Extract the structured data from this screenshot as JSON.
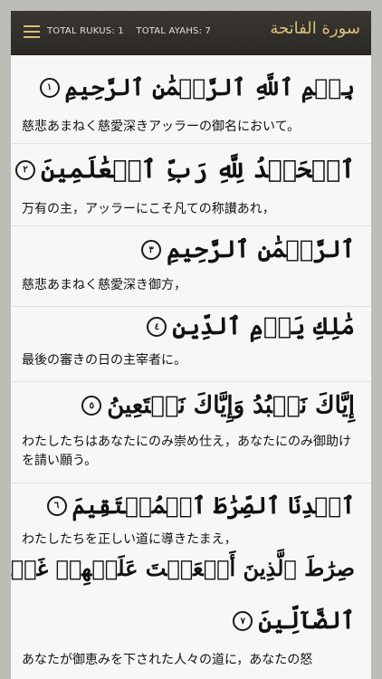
{
  "header": {
    "menu_icon": "hamburger-menu-icon",
    "total_rukus_label": "TOTAL RUKUS: 1",
    "total_ayahs_label": "TOTAL AYAHS: 7",
    "surah_title": "سورة الفاتحة"
  },
  "ayahs": [
    {
      "number": "١",
      "arabic": "بِسۡمِ ٱللَّهِ ٱلرَّحۡمَٰنِ ٱلرَّحِيمِ",
      "translation": "慈悲あまねく慈愛深きアッラーの御名において。"
    },
    {
      "number": "٢",
      "arabic": "ٱلۡحَمۡدُ لِلَّهِ رَبِّ ٱلۡعَٰلَمِينَ",
      "translation": "万有の主，アッラーにこそ凡ての称讃あれ，"
    },
    {
      "number": "٣",
      "arabic": "ٱلرَّحۡمَٰنِ ٱلرَّحِيمِ",
      "translation": "慈悲あまねく慈愛深き御方，"
    },
    {
      "number": "٤",
      "arabic": "مَٰلِكِ يَوۡمِ ٱلدِّينِ",
      "translation": "最後の審きの日の主宰者に。"
    },
    {
      "number": "٥",
      "arabic": "إِيَّاكَ نَعۡبُدُ وَإِيَّاكَ نَسۡتَعِينُ",
      "translation": "わたしたちはあなたにのみ崇め仕え，あなたにのみ御助けを請い願う。"
    },
    {
      "number": "٦",
      "arabic": "ٱهۡدِنَا ٱلصِّرَٰطَ ٱلۡمُسۡتَقِيمَ",
      "translation": "わたしたちを正しい道に導きたまえ，"
    },
    {
      "number": "٧",
      "arabic_line1": "صِرَٰطَ ٱلَّذِينَ أَنۡعَمۡتَ عَلَيۡهِمۡ غَيۡرِ ٱلۡمَغۡضُوبِ عَلَيۡهِمۡ وَلَا",
      "arabic_line2": "ٱلضَّآلِّينَ",
      "translation": "あなたが御恵みを下された人々の道に，あなたの怒"
    }
  ]
}
